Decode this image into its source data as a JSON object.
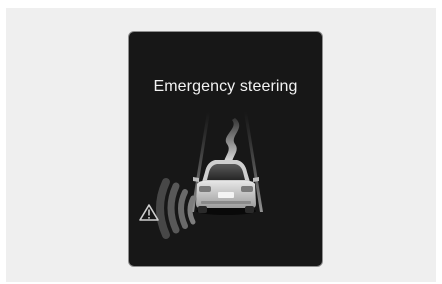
{
  "display": {
    "title": "Emergency steering",
    "warning_icon": "warning-triangle-icon",
    "vehicle_icon": "car-rear-view-icon",
    "path_icon": "s-curve-path-icon",
    "sensor_icon": "side-sensor-wave-icon"
  },
  "colors": {
    "background": "#efefef",
    "screen": "#171717",
    "screen_border": "#8f8f8f",
    "text": "#f2f2f2"
  }
}
